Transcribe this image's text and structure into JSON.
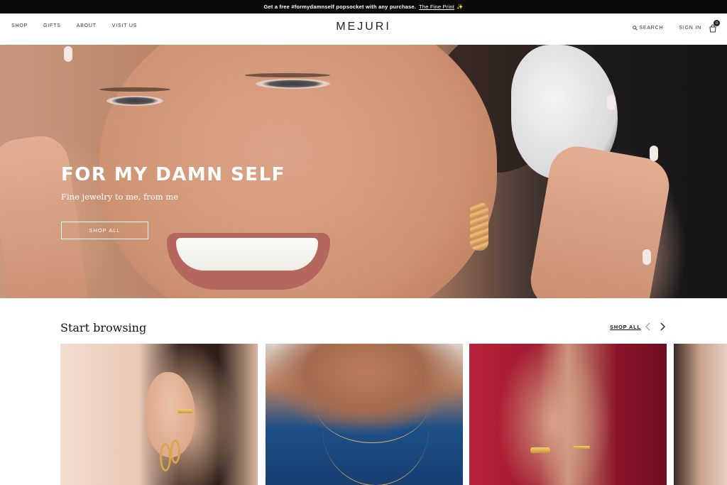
{
  "announcement": {
    "text": "Get a free #formydamnself popsocket with any purchase.",
    "link_text": "The Fine Print",
    "emoji": "✨"
  },
  "header": {
    "nav_left": [
      "SHOP",
      "GIFTS",
      "ABOUT",
      "VISIT US"
    ],
    "logo": "MEJURI",
    "search_label": "SEARCH",
    "signin_label": "SIGN IN",
    "cart_count": "0"
  },
  "hero": {
    "title": "FOR MY DAMN SELF",
    "subtitle": "Fine jewelry to me, from me",
    "button_label": "SHOP ALL",
    "slide_count": 5,
    "active_slide": 1
  },
  "browse": {
    "title": "Start browsing",
    "shop_all_label": "SHOP ALL",
    "cards": [
      {
        "icon": "earrings"
      },
      {
        "icon": "necklaces"
      },
      {
        "icon": "rings"
      },
      {
        "icon": "partial-card"
      }
    ]
  }
}
